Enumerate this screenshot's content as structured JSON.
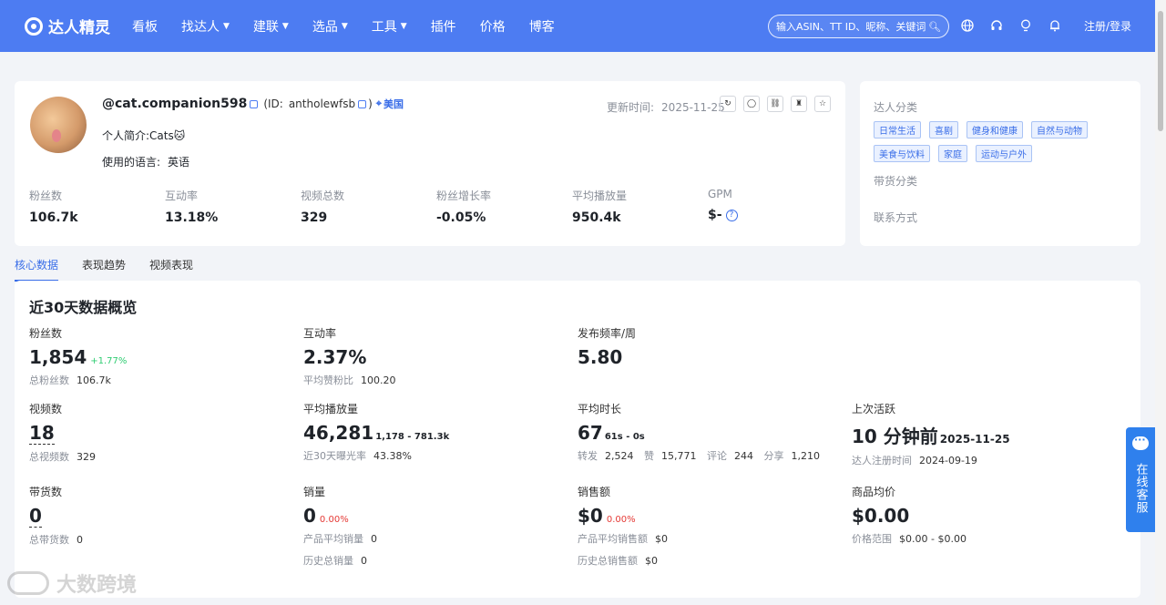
{
  "nav": {
    "brand": "达人精灵",
    "links": [
      {
        "label": "看板",
        "dropdown": false
      },
      {
        "label": "找达人",
        "dropdown": true
      },
      {
        "label": "建联",
        "dropdown": true
      },
      {
        "label": "选品",
        "dropdown": true
      },
      {
        "label": "工具",
        "dropdown": true
      },
      {
        "label": "插件",
        "dropdown": false
      },
      {
        "label": "价格",
        "dropdown": false
      },
      {
        "label": "博客",
        "dropdown": false
      }
    ],
    "search_placeholder": "输入ASIN、TT ID、昵称、关键词",
    "icons": [
      "globe-icon",
      "headset-icon",
      "bulb-icon",
      "bell-icon"
    ],
    "login_label": "注册/登录",
    "accent": "#4d7cf2"
  },
  "profile": {
    "handle": "@cat.companion598",
    "id_prefix": "(ID:",
    "id": "antholewfsb",
    "id_suffix": ")",
    "country": "美国",
    "bio": "个人简介:Cats🐱",
    "language_label": "使用的语言:",
    "language": "英语",
    "updated_label": "更新时间:",
    "updated_value": "2025-11-25",
    "stats": [
      {
        "label": "粉丝数",
        "value": "106.7k"
      },
      {
        "label": "互动率",
        "value": "13.18%"
      },
      {
        "label": "视频总数",
        "value": "329"
      },
      {
        "label": "粉丝增长率",
        "value": "-0.05%"
      },
      {
        "label": "平均播放量",
        "value": "950.4k"
      },
      {
        "label": "GPM",
        "value": "$-"
      }
    ]
  },
  "categories": {
    "title": "达人分类",
    "tags": [
      "日常生活",
      "喜剧",
      "健身和健康",
      "自然与动物",
      "美食与饮料",
      "家庭",
      "运动与户外"
    ],
    "goods_title": "带货分类",
    "contact_title": "联系方式"
  },
  "tabs": [
    "核心数据",
    "表现趋势",
    "视频表现"
  ],
  "overview": {
    "title": "近30天数据概览",
    "followers": {
      "label": "粉丝数",
      "value": "1,854",
      "delta": "+1.77%",
      "sub_label": "总粉丝数",
      "sub_value": "106.7k"
    },
    "engagement": {
      "label": "互动率",
      "value": "2.37%",
      "sub_label": "平均赞粉比",
      "sub_value": "100.20"
    },
    "frequency": {
      "label": "发布频率/周",
      "value": "5.80"
    },
    "videos": {
      "label": "视频数",
      "value": "18",
      "sub_label": "总视频数",
      "sub_value": "329"
    },
    "avg_views": {
      "label": "平均播放量",
      "value": "46,281",
      "range": "1,178 - 781.3k",
      "sub_label": "近30天曝光率",
      "sub_value": "43.38%"
    },
    "avg_duration": {
      "label": "平均时长",
      "value": "67",
      "range": "61s - 0s",
      "interactions": [
        {
          "k": "转发",
          "v": "2,524"
        },
        {
          "k": "赞",
          "v": "15,771"
        },
        {
          "k": "评论",
          "v": "244"
        },
        {
          "k": "分享",
          "v": "1,210"
        }
      ]
    },
    "last_active": {
      "label": "上次活跃",
      "value": "10 分钟前",
      "date": "2025-11-25",
      "sub_label": "达人注册时间",
      "sub_value": "2024-09-19"
    },
    "sales_count": {
      "label": "带货数",
      "value": "0",
      "sub_label": "总带货数",
      "sub_value": "0"
    },
    "volume": {
      "label": "销量",
      "value": "0",
      "delta": "0.00%",
      "sub_label": "产品平均销量",
      "sub_value": "0",
      "sub2_label": "历史总销量",
      "sub2_value": "0"
    },
    "revenue": {
      "label": "销售额",
      "value": "$0",
      "delta": "0.00%",
      "sub_label": "产品平均销售额",
      "sub_value": "$0",
      "sub2_label": "历史总销售额",
      "sub2_value": "$0"
    },
    "avg_price": {
      "label": "商品均价",
      "value": "$0.00",
      "sub_label": "价格范围",
      "sub_value": "$0.00 - $0.00"
    }
  },
  "service_label": "在线客服",
  "watermark": "大数跨境"
}
